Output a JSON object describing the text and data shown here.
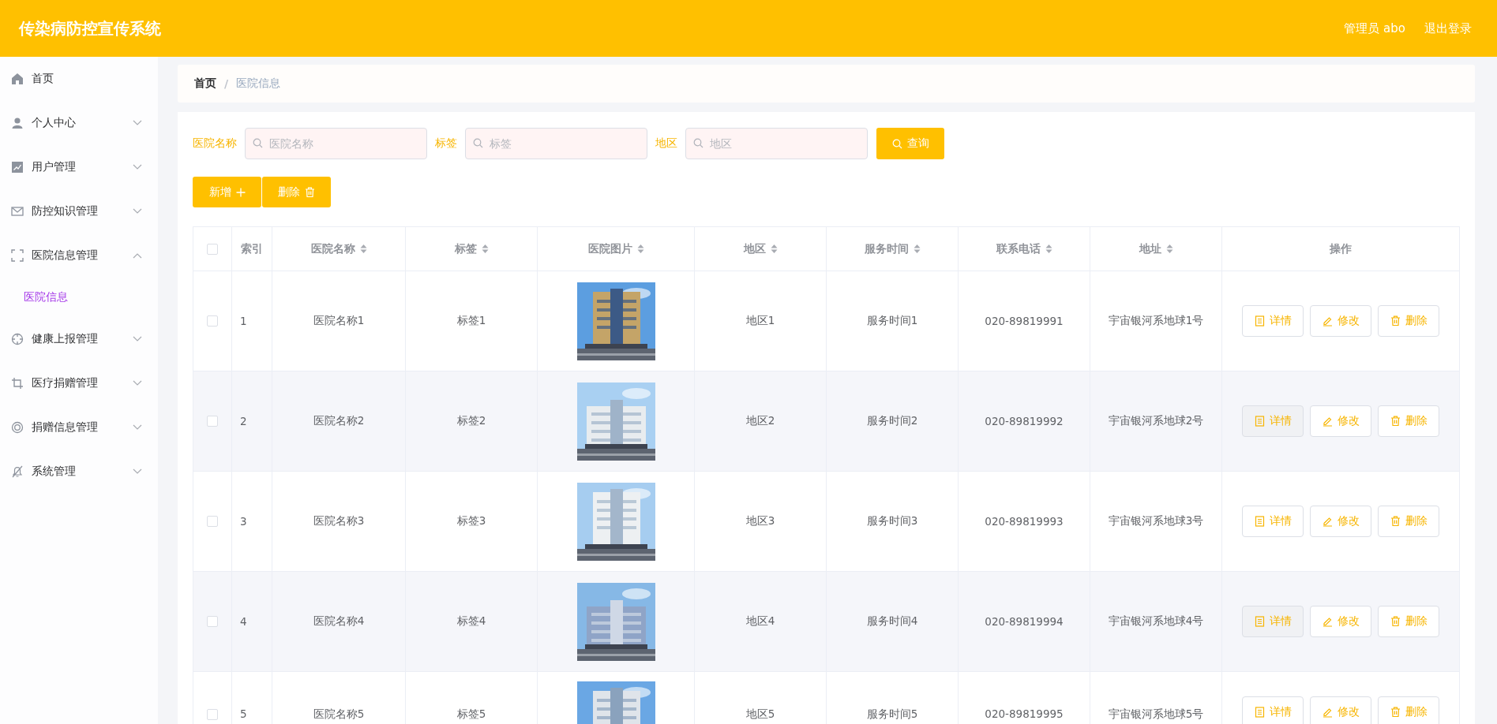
{
  "header": {
    "title": "传染病防控宣传系统",
    "user": "管理员 abo",
    "logout": "退出登录"
  },
  "sidebar": {
    "items": [
      {
        "label": "首页",
        "kind": "link"
      },
      {
        "label": "个人中心",
        "kind": "menu",
        "expanded": false
      },
      {
        "label": "用户管理",
        "kind": "menu",
        "expanded": false
      },
      {
        "label": "防控知识管理",
        "kind": "menu",
        "expanded": false
      },
      {
        "label": "医院信息管理",
        "kind": "menu",
        "expanded": true,
        "children": [
          {
            "label": "医院信息",
            "selected": true
          }
        ]
      },
      {
        "label": "健康上报管理",
        "kind": "menu",
        "expanded": false
      },
      {
        "label": "医疗捐赠管理",
        "kind": "menu",
        "expanded": false
      },
      {
        "label": "捐赠信息管理",
        "kind": "menu",
        "expanded": false
      },
      {
        "label": "系统管理",
        "kind": "menu",
        "expanded": false
      }
    ]
  },
  "breadcrumb": {
    "items": [
      "首页",
      "医院信息"
    ],
    "separator": "/"
  },
  "search": {
    "fields": [
      {
        "label": "医院名称",
        "placeholder": "医院名称"
      },
      {
        "label": "标签",
        "placeholder": "标签"
      },
      {
        "label": "地区",
        "placeholder": "地区"
      }
    ],
    "button": "查询"
  },
  "actions": [
    {
      "label": "新增",
      "kind": "add"
    },
    {
      "label": "删除",
      "kind": "delete"
    }
  ],
  "table": {
    "all_checked": false,
    "columns": [
      {
        "kind": "checkbox"
      },
      {
        "label": "索引",
        "sortable": false
      },
      {
        "label": "医院名称",
        "sortable": true
      },
      {
        "label": "标签",
        "sortable": true
      },
      {
        "label": "医院图片",
        "sortable": true
      },
      {
        "label": "地区",
        "sortable": true
      },
      {
        "label": "服务时间",
        "sortable": true
      },
      {
        "label": "联系电话",
        "sortable": true
      },
      {
        "label": "地址",
        "sortable": true
      },
      {
        "label": "操作",
        "sortable": false
      }
    ],
    "rows": [
      {
        "checked": false,
        "index": "1",
        "name": "医院名称1",
        "tag": "标签1",
        "region": "地区1",
        "hours": "服务时间1",
        "phone": "020-89819991",
        "address": "宇宙银河系地球1号",
        "actions": [
          {
            "label": "详情",
            "kind": "detail"
          },
          {
            "label": "修改",
            "kind": "edit"
          },
          {
            "label": "删除",
            "kind": "delete"
          }
        ]
      },
      {
        "checked": false,
        "index": "2",
        "name": "医院名称2",
        "tag": "标签2",
        "region": "地区2",
        "hours": "服务时间2",
        "phone": "020-89819992",
        "address": "宇宙银河系地球2号",
        "actions": [
          {
            "label": "详情",
            "kind": "detail"
          },
          {
            "label": "修改",
            "kind": "edit"
          },
          {
            "label": "删除",
            "kind": "delete"
          }
        ]
      },
      {
        "checked": false,
        "index": "3",
        "name": "医院名称3",
        "tag": "标签3",
        "region": "地区3",
        "hours": "服务时间3",
        "phone": "020-89819993",
        "address": "宇宙银河系地球3号",
        "actions": [
          {
            "label": "详情",
            "kind": "detail"
          },
          {
            "label": "修改",
            "kind": "edit"
          },
          {
            "label": "删除",
            "kind": "delete"
          }
        ]
      },
      {
        "checked": false,
        "index": "4",
        "name": "医院名称4",
        "tag": "标签4",
        "region": "地区4",
        "hours": "服务时间4",
        "phone": "020-89819994",
        "address": "宇宙银河系地球4号",
        "actions": [
          {
            "label": "详情",
            "kind": "detail"
          },
          {
            "label": "修改",
            "kind": "edit"
          },
          {
            "label": "删除",
            "kind": "delete"
          }
        ]
      },
      {
        "checked": false,
        "index": "5",
        "name": "医院名称5",
        "tag": "标签5",
        "region": "地区5",
        "hours": "服务时间5",
        "phone": "020-89819995",
        "address": "宇宙银河系地球5号",
        "actions": [
          {
            "label": "详情",
            "kind": "detail"
          },
          {
            "label": "修改",
            "kind": "edit"
          },
          {
            "label": "删除",
            "kind": "delete"
          }
        ]
      }
    ]
  }
}
